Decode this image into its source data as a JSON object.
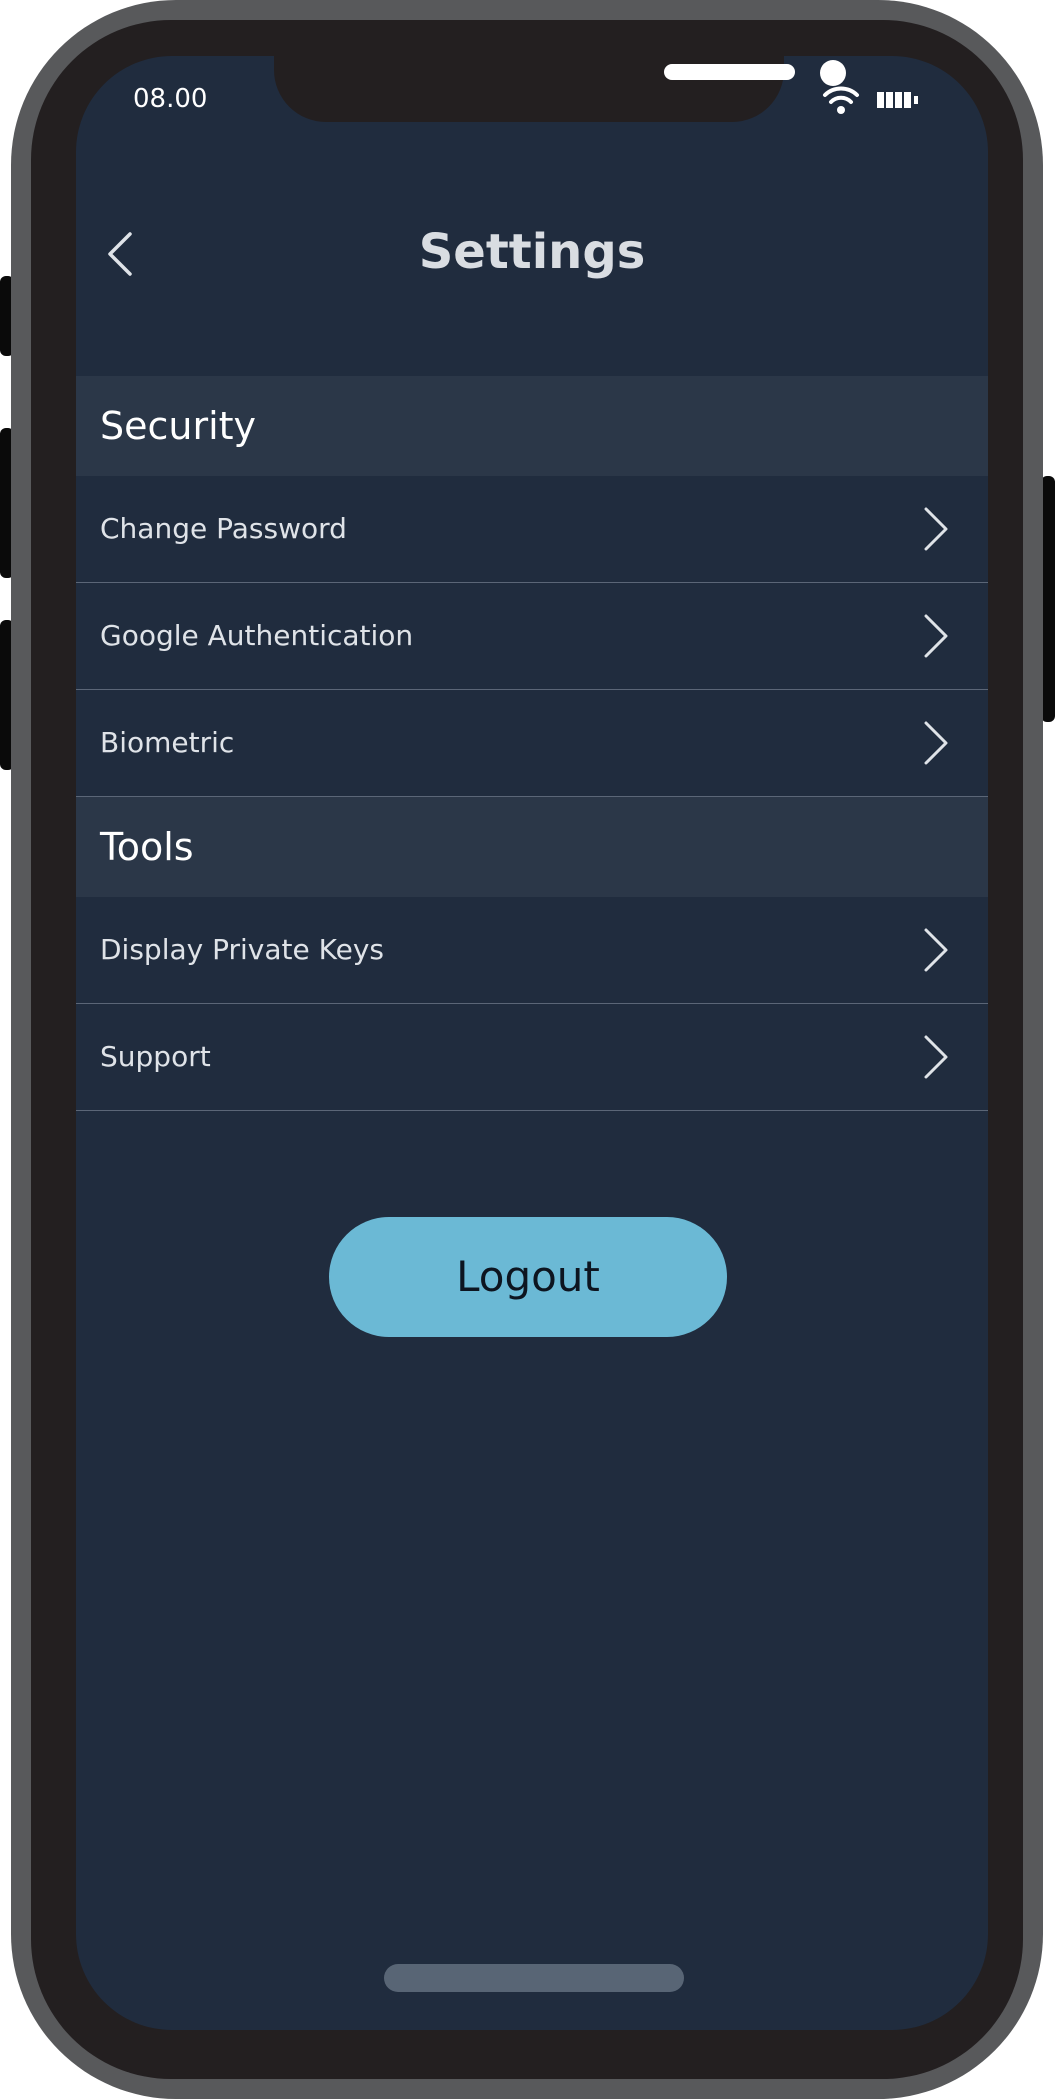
{
  "status_bar": {
    "time": "08.00",
    "wifi_icon": "wifi-icon",
    "battery_icon": "battery-icon"
  },
  "header": {
    "back_icon": "chevron-left-icon",
    "title": "Settings"
  },
  "sections": [
    {
      "title": "Security",
      "items": [
        {
          "label": "Change Password"
        },
        {
          "label": "Google Authentication"
        },
        {
          "label": "Biometric"
        }
      ]
    },
    {
      "title": "Tools",
      "items": [
        {
          "label": "Display Private Keys"
        },
        {
          "label": "Support"
        }
      ]
    }
  ],
  "row_icon": "chevron-right-icon",
  "logout": {
    "label": "Logout"
  },
  "colors": {
    "screen_bg": "#202c3e",
    "section_bg": "#2b3748",
    "accent": "#6bb9d5",
    "divider": "#5b6677"
  }
}
